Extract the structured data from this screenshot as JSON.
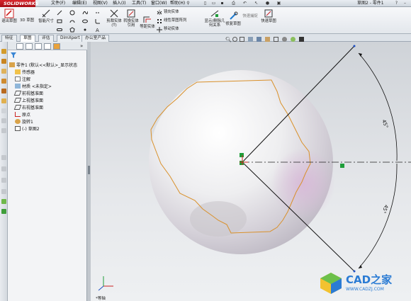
{
  "app": {
    "logo": "SOLIDWORKS",
    "title": "草图2 - 零件1"
  },
  "menu": {
    "items": [
      "文件(F)",
      "编辑(E)",
      "视图(V)",
      "插入(I)",
      "工具(T)",
      "窗口(W)",
      "帮助(H)"
    ]
  },
  "ribbon": {
    "exit_sketch": "退出草图",
    "sketch3d": "3D 草图",
    "smart_dim": "智能尺寸",
    "trim": "剪裁实体(T)",
    "convert": "转换实体引用",
    "offset": "等距实体",
    "mirror": "镜向实体",
    "linear_pattern": "线性草图阵列",
    "move": "移动实体",
    "show_relations": "显示/删除几何关系",
    "repair": "修复草图",
    "quick_snap": "快速捕捉",
    "rapid_sketch": "快速草图"
  },
  "tabs": {
    "items": [
      "特征",
      "草图",
      "评估",
      "DimXpert",
      "办公室产品"
    ],
    "active": 1
  },
  "tree": {
    "items": [
      {
        "label": "零件1 (默认<<默认>_显示状态",
        "indent": 0
      },
      {
        "label": "传感器",
        "indent": 1
      },
      {
        "label": "注解",
        "indent": 1
      },
      {
        "label": "材质 <未指定>",
        "indent": 1
      },
      {
        "label": "前视基准面",
        "indent": 1
      },
      {
        "label": "上视基准面",
        "indent": 1
      },
      {
        "label": "右视基准面",
        "indent": 1
      },
      {
        "label": "原点",
        "indent": 1
      },
      {
        "label": "旋转1",
        "indent": 1
      },
      {
        "label": "(-) 草图2",
        "indent": 1
      }
    ]
  },
  "sketch": {
    "angle_top": "45°",
    "angle_bottom": "45°"
  },
  "triad": {
    "label": "*等轴"
  },
  "watermark": {
    "name": "CAD之家",
    "url": "WWW.CADZJ.COM"
  },
  "colors": {
    "accent": "#d8252c",
    "sketch": "#d9902a",
    "dimension": "#111111",
    "green": "#1f9e3a",
    "brand": "#2a7bd4"
  }
}
